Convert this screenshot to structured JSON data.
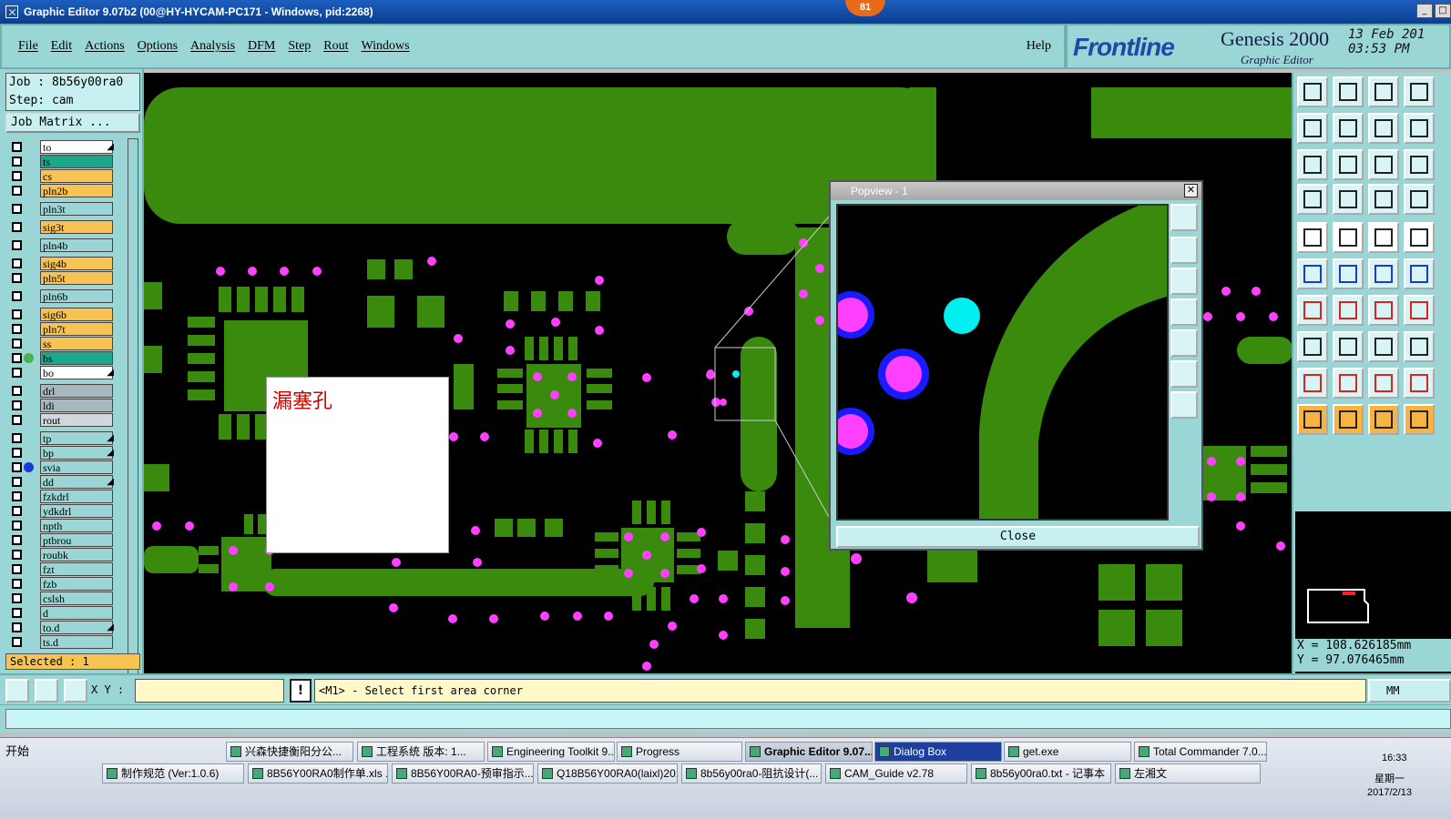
{
  "window": {
    "title": "Graphic Editor 9.07b2 (00@HY-HYCAM-PC171 - Windows, pid:2268)",
    "badge": "81"
  },
  "menu": {
    "items": [
      "File",
      "Edit",
      "Actions",
      "Options",
      "Analysis",
      "DFM",
      "Step",
      "Rout",
      "Windows"
    ],
    "help": "Help"
  },
  "brand": {
    "logo": "Frontline",
    "product": "Genesis 2000",
    "subtitle": "Graphic Editor",
    "date_line1": "13 Feb 201",
    "date_line2": "03:53 PM"
  },
  "job": {
    "job_label": "Job : 8b56y00ra0",
    "step_label": "Step: cam",
    "matrix_button": "Job Matrix ..."
  },
  "layers": [
    {
      "name": "to",
      "color": "#ffffff",
      "arrow": true
    },
    {
      "name": "ts",
      "color": "#1aa88a"
    },
    {
      "name": "cs",
      "color": "#f7c453"
    },
    {
      "name": "pln2b",
      "color": "#f7c453"
    },
    {
      "name": "pln3t",
      "color": "#9ad6d6"
    },
    {
      "name": "sig3t",
      "color": "#f7c453"
    },
    {
      "name": "pln4b",
      "color": "#9ad6d6"
    },
    {
      "name": "sig4b",
      "color": "#f7c453"
    },
    {
      "name": "pln5t",
      "color": "#f7c453"
    },
    {
      "name": "pln6b",
      "color": "#9ad6d6"
    },
    {
      "name": "sig6b",
      "color": "#f7c453"
    },
    {
      "name": "pln7t",
      "color": "#f7c453"
    },
    {
      "name": "ss",
      "color": "#f7c453"
    },
    {
      "name": "bs",
      "color": "#1aa88a",
      "dot": "#4caf50"
    },
    {
      "name": "bo",
      "color": "#ffffff",
      "arrow": true
    },
    {
      "name": "drl",
      "color": "#a8b8c0"
    },
    {
      "name": "ldi",
      "color": "#a8b8c0"
    },
    {
      "name": "rout",
      "color": "#d0d8dc"
    },
    {
      "name": "tp",
      "color": "#9ad6d6",
      "arrow": true
    },
    {
      "name": "bp",
      "color": "#9ad6d6",
      "arrow": true
    },
    {
      "name": "svia",
      "color": "#9ad6d6",
      "dot": "#1a3ad8"
    },
    {
      "name": "dd",
      "color": "#9ad6d6",
      "arrow": true
    },
    {
      "name": "fzkdrl",
      "color": "#9ad6d6"
    },
    {
      "name": "ydkdrl",
      "color": "#9ad6d6"
    },
    {
      "name": "npth",
      "color": "#9ad6d6"
    },
    {
      "name": "ptbrou",
      "color": "#9ad6d6"
    },
    {
      "name": "roubk",
      "color": "#9ad6d6"
    },
    {
      "name": "fzt",
      "color": "#9ad6d6"
    },
    {
      "name": "fzb",
      "color": "#9ad6d6"
    },
    {
      "name": "cslsh",
      "color": "#9ad6d6"
    },
    {
      "name": "d",
      "color": "#9ad6d6"
    },
    {
      "name": "to.d",
      "color": "#9ad6d6",
      "arrow": true
    },
    {
      "name": "ts.d",
      "color": "#9ad6d6"
    }
  ],
  "selected": "Selected : 1",
  "note_text": "漏塞孔",
  "popview": {
    "title": "Popview - 1",
    "close": "Close"
  },
  "coords": {
    "x": "X  = 108.62618",
    "y": "Y  =  97.07646",
    "x_unit": "5mm",
    "y_unit": "5mm"
  },
  "bottom": {
    "xy_label": "X Y :",
    "message": "<M1> - Select first area corner",
    "units": "MM"
  },
  "taskbar": {
    "start": "开始",
    "row1": [
      "兴森快捷衡阳分公...",
      "工程系统  版本: 1...",
      "Engineering Toolkit 9....",
      "Progress",
      "Graphic Editor 9.07...",
      "Dialog Box",
      "get.exe",
      "Total Commander 7.0..."
    ],
    "row2": [
      "制作规范 (Ver:1.0.6)",
      "8B56Y00RA0制作单.xls ...",
      "8B56Y00RA0-预审指示...",
      "Q18B56Y00RA0(laixl)201...",
      "8b56y00ra0-阻抗设计(...",
      "CAM_Guide v2.78",
      "8b56y00ra0.txt - 记事本",
      "左湘文"
    ],
    "time": "16:33",
    "weekday": "星期一",
    "date": "2017/2/13"
  },
  "colors": {
    "copper": "#3a8a0e",
    "pad_magenta": "#ff40ff",
    "via_blue": "#1a1aff",
    "cyan": "#00f0f0",
    "panel": "#9ad6d6"
  }
}
